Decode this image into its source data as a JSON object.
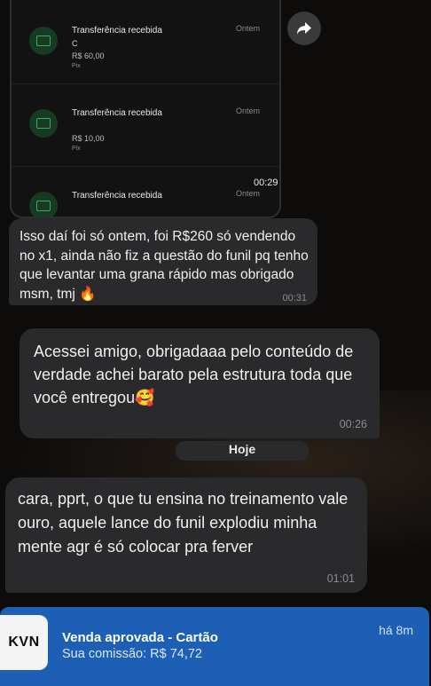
{
  "shared_image": {
    "transactions": [
      {
        "title": "Transferência recebida",
        "when": "Ontem",
        "name": "C",
        "amount": "R$ 60,00",
        "kind": "Pix"
      },
      {
        "title": "Transferência recebida",
        "when": "Ontem",
        "name": "",
        "amount": "R$ 10,00",
        "kind": "Pix"
      },
      {
        "title": "Transferência recebida",
        "when": "Ontem",
        "name": "",
        "amount": "",
        "kind": ""
      }
    ],
    "time": "00:29"
  },
  "messages": [
    {
      "text": "Isso daí foi só ontem, foi R$260 só vendendo no x1, ainda não fiz a questão do funil pq tenho que levantar uma grana rápido mas obrigado msm, tmj 🔥",
      "time": "00:31"
    },
    {
      "text": "Acessei amigo, obrigadaaa pelo conteúdo de verdade achei barato pela estrutura toda que você entregou🥰",
      "time": "00:26"
    },
    {
      "text": "cara, pprt, o que tu ensina no treinamento vale ouro, aquele lance do funil explodiu minha mente agr é só colocar pra ferver",
      "time": "01:01"
    }
  ],
  "date_divider": "Hoje",
  "notification": {
    "app_icon_text": "KVN",
    "title": "Venda aprovada - Cartão",
    "body": "Sua comissão: R$ 74,72",
    "age": "há 8m",
    "color": "#1d5fb4"
  },
  "icons": {
    "forward": "forward-arrow-icon",
    "transfer": "transfer-received-icon"
  }
}
